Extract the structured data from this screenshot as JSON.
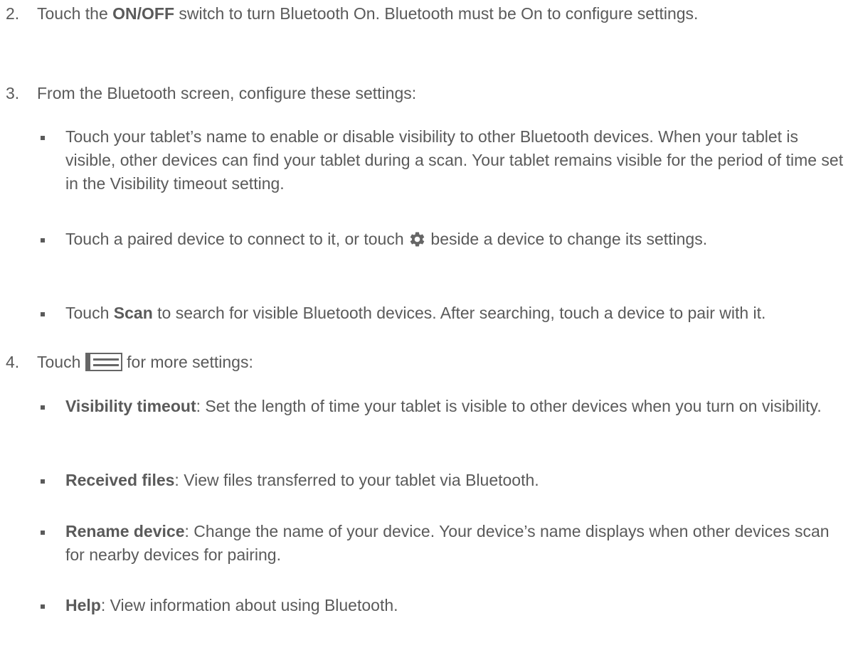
{
  "steps": [
    {
      "number": "2.",
      "before": "Touch the ",
      "bold": "ON/OFF",
      "after": " switch to turn Bluetooth On. Bluetooth must be On to configure settings."
    },
    {
      "number": "3.",
      "text": "From the Bluetooth screen, configure these settings:"
    },
    {
      "number": "4.",
      "before": "Touch ",
      "after": " for more settings:",
      "icon": "menu-icon"
    }
  ],
  "step3_bullets": [
    {
      "text": "Touch your tablet’s name to enable or disable visibility to other Bluetooth devices. When your tablet is visible, other devices can find your tablet during a scan. Your tablet remains visible for the period of time set in the Visibility timeout setting."
    },
    {
      "before": "Touch a paired device to connect to it, or touch ",
      "after": " beside a device to change its settings.",
      "icon": "gear-icon"
    },
    {
      "before": "Touch ",
      "bold": "Scan",
      "after": " to search for visible Bluetooth devices. After searching, touch a device to pair with it."
    }
  ],
  "step4_bullets": [
    {
      "bold": "Visibility timeout",
      "after": ": Set the length of time your tablet is visible to other devices when you turn on visibility."
    },
    {
      "bold": "Received files",
      "after": ": View files transferred to your tablet via Bluetooth."
    },
    {
      "bold": "Rename device",
      "after": ": Change the name of your device. Your device’s name displays when other devices scan for nearby devices for pairing."
    },
    {
      "bold": "Help",
      "after": ": View information about using Bluetooth."
    }
  ],
  "colors": {
    "text": "#5a5a5a",
    "icon": "#666666"
  }
}
